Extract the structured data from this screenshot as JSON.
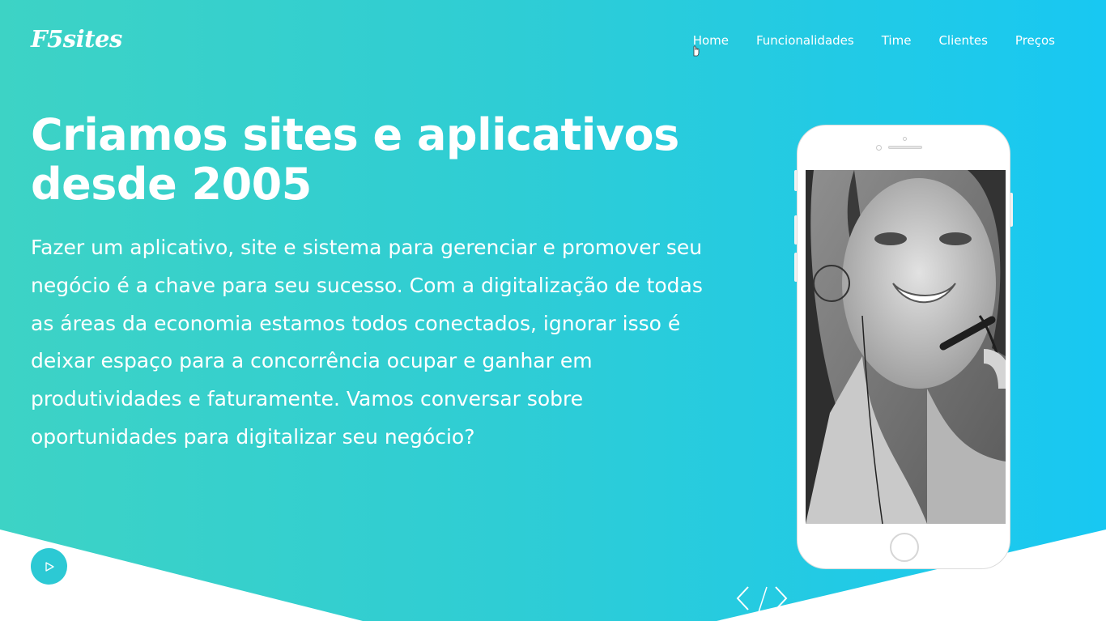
{
  "brand": {
    "logo_text": "F5sites"
  },
  "nav": {
    "items": [
      {
        "label": "Home"
      },
      {
        "label": "Funcionalidades"
      },
      {
        "label": "Time"
      },
      {
        "label": "Clientes"
      },
      {
        "label": "Preços"
      }
    ]
  },
  "hero": {
    "title_line1": "Criamos sites e aplicativos",
    "title_line2": "desde 2005",
    "description": "Fazer um aplicativo, site e sistema para gerenciar e promover seu negócio é a chave para seu sucesso. Com a digitalização de todas as áreas da economia estamos todos conectados, ignorar isso é deixar espaço para a concorrência ocupar e ganhar em produtividades e faturamente. Vamos conversar sobre oportunidades para digitalizar seu negócio?"
  },
  "controls": {
    "play_icon": "play-icon",
    "prev_icon": "chevron-left-icon",
    "next_icon": "chevron-right-icon",
    "separator": "/"
  },
  "phone": {
    "image": "woman-with-headset-photo"
  },
  "colors": {
    "gradient_start": "#3dd3c5",
    "gradient_end": "#18c8f2",
    "text": "#ffffff",
    "play_button": "#2cc9d4"
  }
}
